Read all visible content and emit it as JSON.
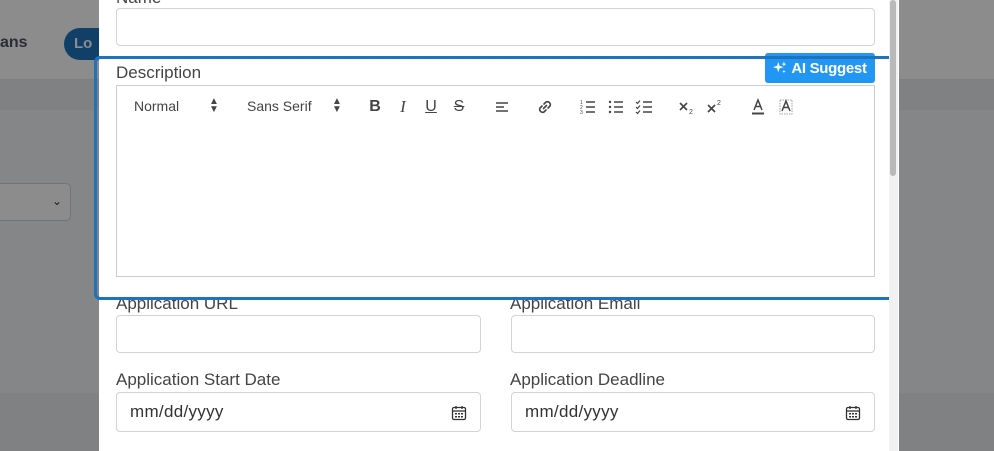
{
  "background": {
    "nav_text": "ans",
    "nav_pill": "Lo"
  },
  "modal": {
    "name_label": "Name",
    "description": {
      "label": "Description",
      "ai_suggest_label": "AI Suggest",
      "toolbar": {
        "header_select": "Normal",
        "font_select": "Sans Serif",
        "icons": [
          "bold-icon",
          "italic-icon",
          "underline-icon",
          "strike-icon",
          "align-icon",
          "link-icon",
          "ordered-list-icon",
          "bullet-list-icon",
          "check-list-icon",
          "subscript-icon",
          "superscript-icon",
          "text-color-icon",
          "background-color-icon"
        ]
      },
      "content": ""
    },
    "application_url": {
      "label": "Application URL",
      "value": ""
    },
    "application_email": {
      "label": "Application Email",
      "value": ""
    },
    "application_start_date": {
      "label": "Application Start Date",
      "placeholder": "mm/dd/yyyy"
    },
    "application_deadline": {
      "label": "Application Deadline",
      "placeholder": "mm/dd/yyyy"
    }
  },
  "colors": {
    "accent": "#1e73be",
    "ai_button": "#2196f3"
  }
}
